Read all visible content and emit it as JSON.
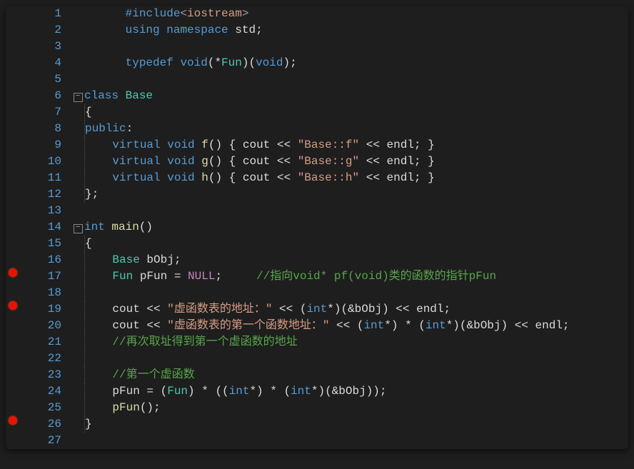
{
  "breakpoints": [
    17,
    19,
    26
  ],
  "fold_markers": {
    "6": "-",
    "14": "-"
  },
  "lines": {
    "1": [
      {
        "cls": "inc",
        "t": "      "
      },
      {
        "cls": "kw",
        "t": "#include"
      },
      {
        "cls": "inc",
        "t": "<"
      },
      {
        "cls": "str",
        "t": "iostream"
      },
      {
        "cls": "inc",
        "t": ">"
      }
    ],
    "2": [
      {
        "cls": "plain",
        "t": "      "
      },
      {
        "cls": "kw",
        "t": "using"
      },
      {
        "cls": "plain",
        "t": " "
      },
      {
        "cls": "kw",
        "t": "namespace"
      },
      {
        "cls": "plain",
        "t": " std;"
      }
    ],
    "3": [
      {
        "cls": "plain",
        "t": ""
      }
    ],
    "4": [
      {
        "cls": "plain",
        "t": "      "
      },
      {
        "cls": "kw",
        "t": "typedef"
      },
      {
        "cls": "plain",
        "t": " "
      },
      {
        "cls": "kw",
        "t": "void"
      },
      {
        "cls": "plain",
        "t": "(*"
      },
      {
        "cls": "type",
        "t": "Fun"
      },
      {
        "cls": "plain",
        "t": ")("
      },
      {
        "cls": "kw",
        "t": "void"
      },
      {
        "cls": "plain",
        "t": ");"
      }
    ],
    "5": [
      {
        "cls": "plain",
        "t": ""
      }
    ],
    "6": [
      {
        "cls": "kw",
        "t": "class"
      },
      {
        "cls": "plain",
        "t": " "
      },
      {
        "cls": "type",
        "t": "Base"
      }
    ],
    "7": [
      {
        "cls": "plain",
        "t": "{"
      }
    ],
    "8": [
      {
        "cls": "kw",
        "t": "public"
      },
      {
        "cls": "plain",
        "t": ":"
      }
    ],
    "9": [
      {
        "cls": "plain",
        "t": "    "
      },
      {
        "cls": "kw",
        "t": "virtual"
      },
      {
        "cls": "plain",
        "t": " "
      },
      {
        "cls": "kw",
        "t": "void"
      },
      {
        "cls": "plain",
        "t": " "
      },
      {
        "cls": "func",
        "t": "f"
      },
      {
        "cls": "plain",
        "t": "() { cout << "
      },
      {
        "cls": "str",
        "t": "\"Base::f\""
      },
      {
        "cls": "plain",
        "t": " << endl; }"
      }
    ],
    "10": [
      {
        "cls": "plain",
        "t": "    "
      },
      {
        "cls": "kw",
        "t": "virtual"
      },
      {
        "cls": "plain",
        "t": " "
      },
      {
        "cls": "kw",
        "t": "void"
      },
      {
        "cls": "plain",
        "t": " "
      },
      {
        "cls": "func",
        "t": "g"
      },
      {
        "cls": "plain",
        "t": "() { cout << "
      },
      {
        "cls": "str",
        "t": "\"Base::g\""
      },
      {
        "cls": "plain",
        "t": " << endl; }"
      }
    ],
    "11": [
      {
        "cls": "plain",
        "t": "    "
      },
      {
        "cls": "kw",
        "t": "virtual"
      },
      {
        "cls": "plain",
        "t": " "
      },
      {
        "cls": "kw",
        "t": "void"
      },
      {
        "cls": "plain",
        "t": " "
      },
      {
        "cls": "func",
        "t": "h"
      },
      {
        "cls": "plain",
        "t": "() { cout << "
      },
      {
        "cls": "str",
        "t": "\"Base::h\""
      },
      {
        "cls": "plain",
        "t": " << endl; }"
      }
    ],
    "12": [
      {
        "cls": "plain",
        "t": "};"
      }
    ],
    "13": [
      {
        "cls": "plain",
        "t": ""
      }
    ],
    "14": [
      {
        "cls": "kw",
        "t": "int"
      },
      {
        "cls": "plain",
        "t": " "
      },
      {
        "cls": "func",
        "t": "main"
      },
      {
        "cls": "plain",
        "t": "()"
      }
    ],
    "15": [
      {
        "cls": "plain",
        "t": "{"
      }
    ],
    "16": [
      {
        "cls": "plain",
        "t": "    "
      },
      {
        "cls": "type",
        "t": "Base"
      },
      {
        "cls": "plain",
        "t": " bObj;"
      }
    ],
    "17": [
      {
        "cls": "plain",
        "t": "    "
      },
      {
        "cls": "type",
        "t": "Fun"
      },
      {
        "cls": "plain",
        "t": " pFun = "
      },
      {
        "cls": "null",
        "t": "NULL"
      },
      {
        "cls": "plain",
        "t": ";     "
      },
      {
        "cls": "com",
        "t": "//指向void* pf(void)类的函数的指针pFun"
      }
    ],
    "18": [
      {
        "cls": "plain",
        "t": ""
      }
    ],
    "19": [
      {
        "cls": "plain",
        "t": "    cout << "
      },
      {
        "cls": "str",
        "t": "\"虚函数表的地址：\""
      },
      {
        "cls": "plain",
        "t": " << ("
      },
      {
        "cls": "kw",
        "t": "int"
      },
      {
        "cls": "plain",
        "t": "*)(&bObj) << endl;"
      }
    ],
    "20": [
      {
        "cls": "plain",
        "t": "    cout << "
      },
      {
        "cls": "str",
        "t": "\"虚函数表的第一个函数地址：\""
      },
      {
        "cls": "plain",
        "t": " << ("
      },
      {
        "cls": "kw",
        "t": "int"
      },
      {
        "cls": "plain",
        "t": "*) * ("
      },
      {
        "cls": "kw",
        "t": "int"
      },
      {
        "cls": "plain",
        "t": "*)(&bObj) << endl;"
      }
    ],
    "21": [
      {
        "cls": "plain",
        "t": "    "
      },
      {
        "cls": "com",
        "t": "//再次取址得到第一个虚函数的地址"
      }
    ],
    "22": [
      {
        "cls": "plain",
        "t": ""
      }
    ],
    "23": [
      {
        "cls": "plain",
        "t": "    "
      },
      {
        "cls": "com",
        "t": "//第一个虚函数"
      }
    ],
    "24": [
      {
        "cls": "plain",
        "t": "    pFun = ("
      },
      {
        "cls": "type",
        "t": "Fun"
      },
      {
        "cls": "plain",
        "t": ") * (("
      },
      {
        "cls": "kw",
        "t": "int"
      },
      {
        "cls": "plain",
        "t": "*) * ("
      },
      {
        "cls": "kw",
        "t": "int"
      },
      {
        "cls": "plain",
        "t": "*)(&bObj));"
      }
    ],
    "25": [
      {
        "cls": "plain",
        "t": "    "
      },
      {
        "cls": "func",
        "t": "pFun"
      },
      {
        "cls": "plain",
        "t": "();"
      }
    ],
    "26": [
      {
        "cls": "plain",
        "t": "}"
      }
    ],
    "27": [
      {
        "cls": "plain",
        "t": ""
      }
    ]
  },
  "line_count": 27
}
